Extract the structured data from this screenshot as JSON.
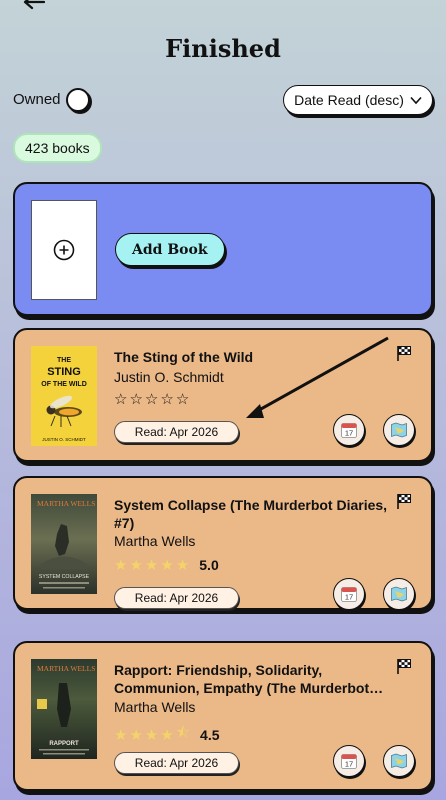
{
  "header": {
    "title": "Finished"
  },
  "filters": {
    "owned_label": "Owned",
    "sort_label": "Date Read (desc)"
  },
  "library": {
    "count_label": "423 books"
  },
  "add_card": {
    "button_label": "Add Book"
  },
  "books": [
    {
      "title": "The Sting of the Wild",
      "author": "Justin O. Schmidt",
      "rating": null,
      "stars_filled": 0,
      "read_label": "Read: Apr 2026",
      "cover": {
        "line1": "THE",
        "line2": "STING",
        "line3": "OF THE WILD",
        "author": "JUSTIN O. SCHMIDT"
      }
    },
    {
      "title": "System Collapse (The Murderbot Diaries, #7)",
      "author": "Martha Wells",
      "rating": "5.0",
      "stars_filled": 5,
      "read_label": "Read: Apr 2026",
      "cover": {
        "author": "MARTHA WELLS",
        "title": "SYSTEM COLLAPSE"
      }
    },
    {
      "title": "Rapport: Friendship, Solidarity, Communion, Empathy (The Murderbot…",
      "author": "Martha Wells",
      "rating": "4.5",
      "stars_filled": 4.5,
      "read_label": "Read: Apr 2026",
      "cover": {
        "author": "MARTHA WELLS",
        "title": "RAPPORT"
      }
    }
  ],
  "calendar_icon": {
    "day": "17"
  },
  "colors": {
    "add_card": "#7a8cf2",
    "book_card": "#ebb888",
    "add_button": "#a6f2f3",
    "count_badge": "#dafadf",
    "star_filled": "#f3d36a"
  }
}
